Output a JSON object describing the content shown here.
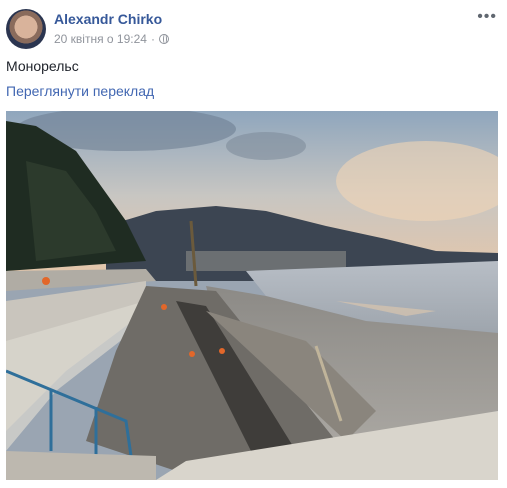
{
  "post": {
    "author": "Alexandr Chirko",
    "date": "20 квітня о 19:24",
    "separator": "·",
    "privacy_icon": "globe-icon",
    "more_options": "•••",
    "text": "Монорельс",
    "translate_link": "Переглянути переклад"
  },
  "colors": {
    "author_link": "#365899",
    "translate_link": "#4267b2",
    "meta_text": "#90949c"
  }
}
